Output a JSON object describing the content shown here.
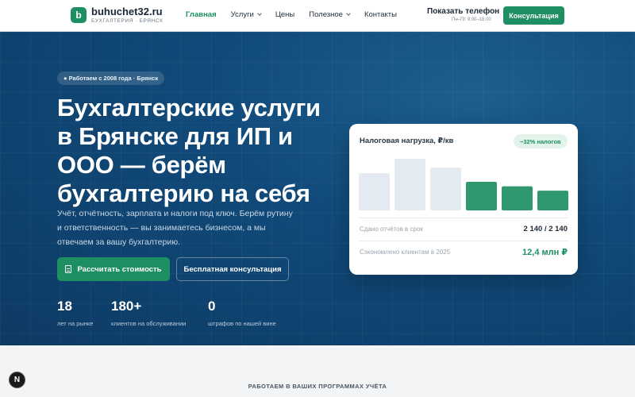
{
  "header": {
    "logo_letter": "b",
    "site_name": "buhuchet32.ru",
    "tagline": "БУХГАЛТЕРИЯ · БРЯНСК",
    "nav": [
      {
        "label": "Главная",
        "active": true,
        "has_dropdown": false
      },
      {
        "label": "Услуги",
        "active": false,
        "has_dropdown": true
      },
      {
        "label": "Цены",
        "active": false,
        "has_dropdown": false
      },
      {
        "label": "Полезное",
        "active": false,
        "has_dropdown": true
      },
      {
        "label": "Контакты",
        "active": false,
        "has_dropdown": false
      }
    ],
    "phone_label": "Показать телефон",
    "hours": "Пн–Пт 9:00–18:00",
    "consult_button": "Консультация"
  },
  "hero": {
    "badge": "● Работаем с 2008 года · Брянск",
    "headline": "Бухгалтерские услуги в Брянске для ИП и ООО — берём бухгалтерию на себя",
    "lead": "Учёт, отчётность, зарплата и налоги под ключ. Берём рутину и ответственность — вы занимаетесь бизнесом, а мы отвечаем за вашу бухгалтерию.",
    "primary_button": "Рассчитать стоимость",
    "secondary_button": "Бесплатная консультация",
    "stats": [
      {
        "value": "18",
        "label": "лет на рынке"
      },
      {
        "value": "180+",
        "label": "клиентов на обслуживании"
      },
      {
        "value": "0",
        "label": "штрафов по нашей вине"
      }
    ]
  },
  "card": {
    "title": "Налоговая нагрузка, ₽/кв",
    "badge": "−32% налогов",
    "rows": [
      {
        "label": "Сдано отчётов в срок",
        "value": "2 140 / 2 140"
      },
      {
        "label": "Сэкономлено клиентам в 2025",
        "value": "12,4 млн ₽"
      }
    ]
  },
  "chart_data": {
    "type": "bar",
    "title": "Налоговая нагрузка, ₽/кв",
    "values": [
      34,
      47,
      39,
      26,
      22,
      18
    ],
    "highlighted": [
      false,
      false,
      false,
      true,
      true,
      true
    ],
    "colors": {
      "muted": "#e3eaf2",
      "accent": "#1e8f62"
    }
  },
  "footer_strip": {
    "title": "РАБОТАЕМ В ВАШИХ ПРОГРАММАХ УЧЁТА"
  },
  "dev_badge": "N",
  "colors": {
    "brand": "#1e8f62",
    "hero_bg": "#114a7a"
  }
}
